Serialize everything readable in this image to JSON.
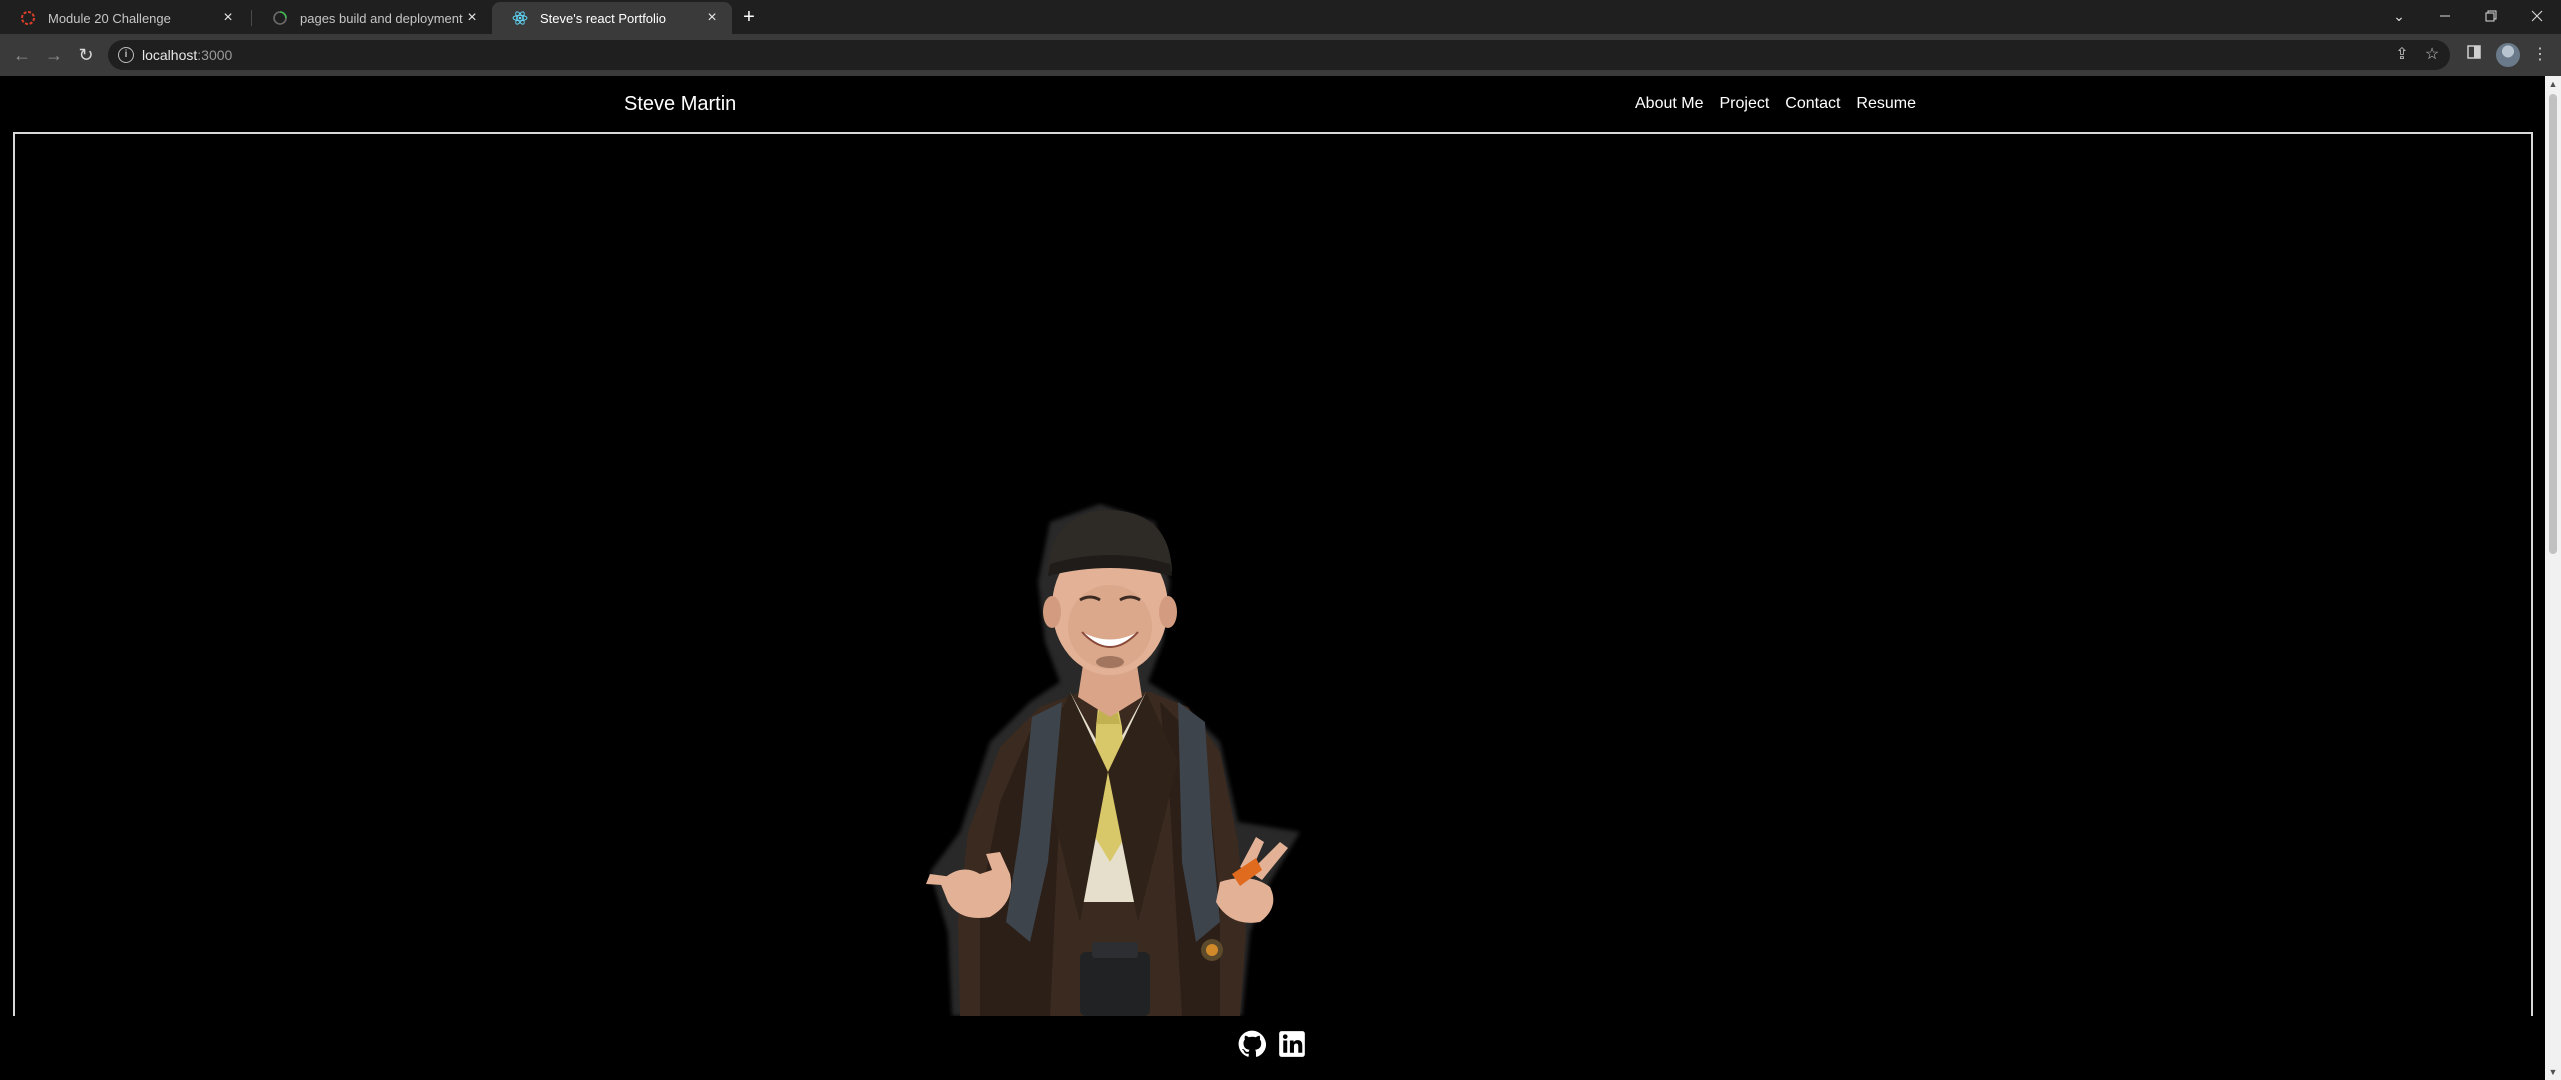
{
  "browser": {
    "tabs": [
      {
        "title": "Module 20 Challenge",
        "icon": "spinner-icon",
        "active": false
      },
      {
        "title": "pages build and deployment · W",
        "icon": "loading-icon",
        "active": false
      },
      {
        "title": "Steve's react Portfolio",
        "icon": "react-icon",
        "active": true
      }
    ],
    "new_tab": "+",
    "url_host": "localhost",
    "url_port": ":3000"
  },
  "site": {
    "brand": "Steve Martin",
    "nav": [
      "About Me",
      "Project",
      "Contact",
      "Resume"
    ],
    "footer_links": [
      {
        "icon": "github-icon"
      },
      {
        "icon": "linkedin-icon"
      }
    ]
  },
  "colors": {
    "page_bg": "#000000",
    "text": "#ffffff",
    "frame_border": "#d9d9d9",
    "tabbar_bg": "#1f1f1f",
    "toolbar_bg": "#3a3a3a"
  }
}
